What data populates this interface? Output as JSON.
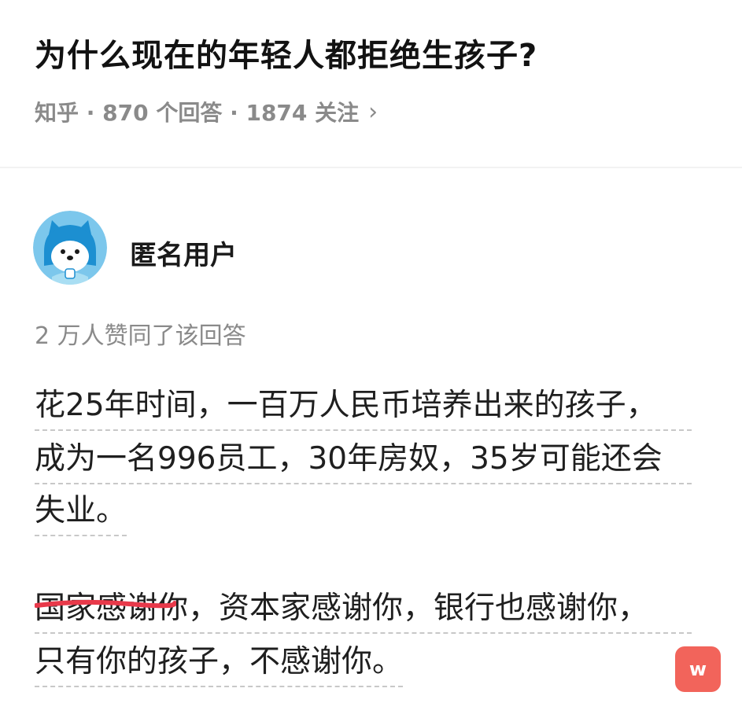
{
  "question": {
    "title": "为什么现在的年轻人都拒绝生孩子?",
    "meta": "知乎 · 870 个回答 · 1874 关注",
    "chevron": "›"
  },
  "answer": {
    "author": {
      "name": "匿名用户",
      "avatar_icon": "anonymous-mascot-avatar"
    },
    "agree_text": "2 万人赞同了该回答",
    "lines": [
      "花25年时间，一百万人民币培养出来的孩子，",
      "成为一名996员工，30年房奴，35岁可能还会",
      "失业。",
      "国家感谢你，资本家感谢你，银行也感谢你，",
      "只有你的孩子，不感谢你。"
    ]
  },
  "badge": {
    "label": "w",
    "color": "#f2645b",
    "icon": "w-badge-icon"
  },
  "colors": {
    "annotation_stroke": "#e8394a",
    "meta_gray": "#8a8a8a"
  }
}
